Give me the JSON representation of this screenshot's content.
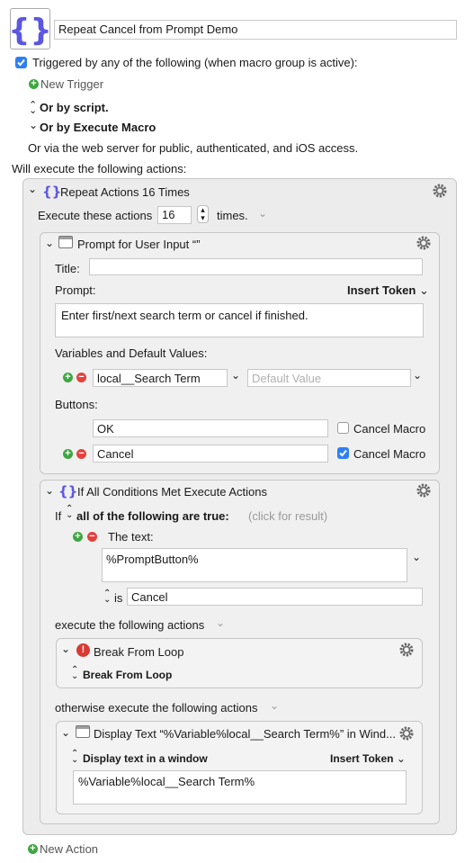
{
  "macro": {
    "title": "Repeat Cancel from Prompt Demo"
  },
  "trigger": {
    "checkbox_label": "Triggered by any of the following (when macro group is active):",
    "new_trigger": "New Trigger",
    "or_by_script": "Or by script.",
    "or_by_execute_macro": "Or by Execute Macro",
    "web_server": "Or via the web server for public, authenticated, and iOS access."
  },
  "will_execute": "Will execute the following actions:",
  "repeat": {
    "title": "Repeat Actions 16 Times",
    "execute_label": "Execute these actions",
    "count": "16",
    "times_label": "times."
  },
  "prompt": {
    "title": "Prompt for User Input “”",
    "title_label": "Title:",
    "title_value": "",
    "prompt_label": "Prompt:",
    "insert_token": "Insert Token",
    "prompt_value": "Enter first/next search term or cancel if finished.",
    "variables_label": "Variables and Default Values:",
    "variable_name": "local__Search Term",
    "default_value_placeholder": "Default Value",
    "buttons_label": "Buttons:",
    "button1": "OK",
    "button1_cancel": "Cancel Macro",
    "button1_cancel_checked": false,
    "button2": "Cancel",
    "button2_cancel": "Cancel Macro",
    "button2_cancel_checked": true
  },
  "ifall": {
    "title": "If All Conditions Met Execute Actions",
    "if_label": "If",
    "all_label": "all of the following are true:",
    "click_result": "(click for result)",
    "the_text_label": "The text:",
    "text_value": "%PromptButton%",
    "is_label": "is",
    "is_value": "Cancel",
    "execute_label": "execute the following actions",
    "otherwise_label": "otherwise execute the following actions"
  },
  "break": {
    "title": "Break From Loop",
    "sub": "Break From Loop"
  },
  "display": {
    "title": "Display Text “%Variable%local__Search Term%” in Wind...",
    "mode": "Display text in a window",
    "insert_token": "Insert Token",
    "text_value": "%Variable%local__Search Term%"
  },
  "new_action": "New Action",
  "colors": {
    "accent_blue": "#2f7ff2",
    "add_green": "#3ea642",
    "remove_red": "#e4413d",
    "brace_purple": "#5b57e0"
  }
}
